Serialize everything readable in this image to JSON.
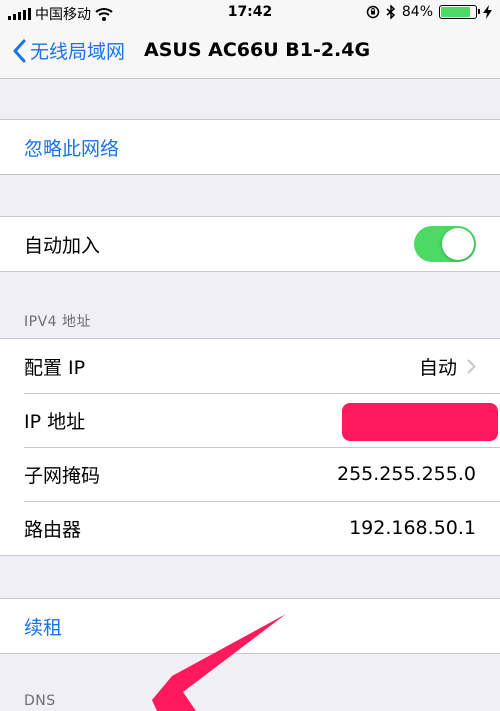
{
  "status_bar": {
    "carrier": "中国移动",
    "time": "17:42",
    "battery_percent": "84%",
    "battery_level": 0.84,
    "battery_color": "#4cd964"
  },
  "nav": {
    "back_label": "无线局域网",
    "title": "ASUS AC66U B1-2.4G"
  },
  "forget_network": "忽略此网络",
  "auto_join": {
    "label": "自动加入",
    "on": true
  },
  "ipv4": {
    "section_title": "IPV4 地址",
    "configure_ip": {
      "label": "配置 IP",
      "value": "自动"
    },
    "ip_address": {
      "label": "IP 地址"
    },
    "subnet_mask": {
      "label": "子网掩码",
      "value": "255.255.255.0"
    },
    "router": {
      "label": "路由器",
      "value": "192.168.50.1"
    }
  },
  "renew_lease": "续租",
  "dns": {
    "section_title": "DNS"
  },
  "colors": {
    "accent": "#1a73e8",
    "toggle_on": "#4cd964",
    "annotation": "#ff1a5e"
  },
  "icons": [
    "wifi-icon",
    "lock-rotation-icon",
    "bluetooth-icon",
    "charging-icon",
    "chevron-left-icon",
    "chevron-right-icon",
    "annotation-arrow"
  ]
}
